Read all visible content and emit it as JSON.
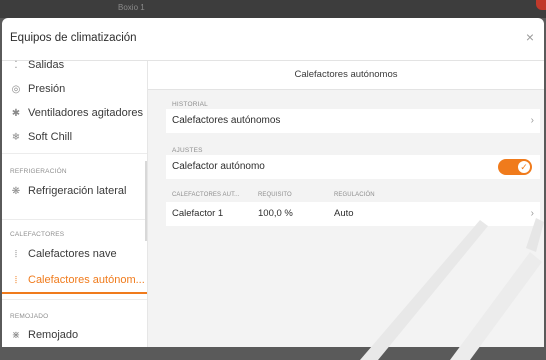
{
  "window": {
    "title": "Boxio 1"
  },
  "header": {
    "title": "Equipos de climatización",
    "close": "×"
  },
  "sidebar": {
    "items_top": [
      {
        "label": "Salidas",
        "icon": "outputs-icon"
      },
      {
        "label": "Presión",
        "icon": "pressure-icon"
      },
      {
        "label": "Ventiladores agitadores",
        "icon": "fan-icon"
      },
      {
        "label": "Soft Chill",
        "icon": "soft-chill-icon"
      }
    ],
    "cat_refrigeracion": "REFRIGERACIÓN",
    "item_refrigeracion": "Refrigeración lateral",
    "cat_calefactores": "CALEFACTORES",
    "item_calefactores_nave": "Calefactores nave",
    "item_calefactores_autonomos": "Calefactores autónom...",
    "cat_remojado": "REMOJADO",
    "item_remojado": "Remojado"
  },
  "main": {
    "title": "Calefactores autónomos",
    "historial_label": "HISTORIAL",
    "historial_row": "Calefactores autónomos",
    "ajustes_label": "AJUSTES",
    "ajustes_row": "Calefactor autónomo",
    "toggle_on": true,
    "table": {
      "headers": [
        "CALEFACTORES AUT...",
        "REQUISITO",
        "REGULACIÓN"
      ],
      "rows": [
        {
          "name": "Calefactor 1",
          "requisito": "100,0 %",
          "regulacion": "Auto"
        }
      ]
    }
  },
  "colors": {
    "accent": "#f07b1c",
    "background": "#f3f3f3"
  }
}
